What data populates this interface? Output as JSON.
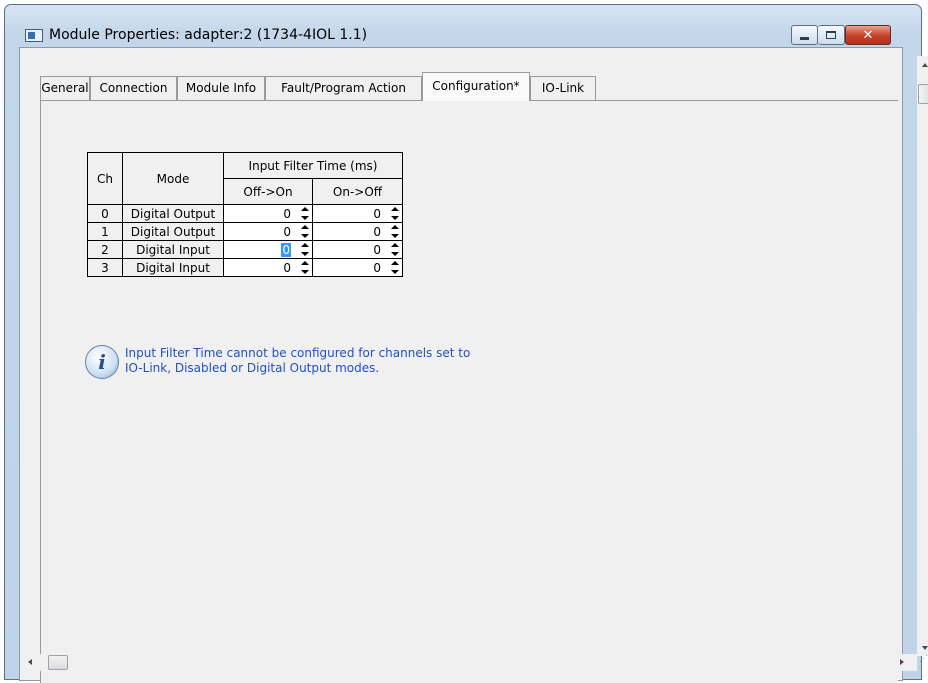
{
  "window": {
    "title": "Module Properties: adapter:2 (1734-4IOL 1.1)",
    "close_glyph": "✕"
  },
  "tabs": [
    {
      "label": "General",
      "active": false
    },
    {
      "label": "Connection",
      "active": false
    },
    {
      "label": "Module Info",
      "active": false
    },
    {
      "label": "Fault/Program Action",
      "active": false
    },
    {
      "label": "Configuration*",
      "active": true
    },
    {
      "label": "IO-Link",
      "active": false
    }
  ],
  "config_table": {
    "headers": {
      "ch": "Ch",
      "mode": "Mode",
      "filter_group": "Input Filter Time (ms)",
      "off_on": "Off->On",
      "on_off": "On->Off"
    },
    "rows": [
      {
        "ch": "0",
        "mode": "Digital Output",
        "off_on": "0",
        "on_off": "0"
      },
      {
        "ch": "1",
        "mode": "Digital Output",
        "off_on": "0",
        "on_off": "0"
      },
      {
        "ch": "2",
        "mode": "Digital Input",
        "off_on": "0",
        "on_off": "0"
      },
      {
        "ch": "3",
        "mode": "Digital Input",
        "off_on": "0",
        "on_off": "0"
      }
    ]
  },
  "info": {
    "icon": "info-icon",
    "line1": "Input Filter Time cannot be configured for channels set to",
    "line2": "IO-Link, Disabled or Digital Output modes."
  },
  "colors": {
    "info_text": "#1e50c8",
    "selection": "#3399ff",
    "close_button": "#c7462c"
  }
}
